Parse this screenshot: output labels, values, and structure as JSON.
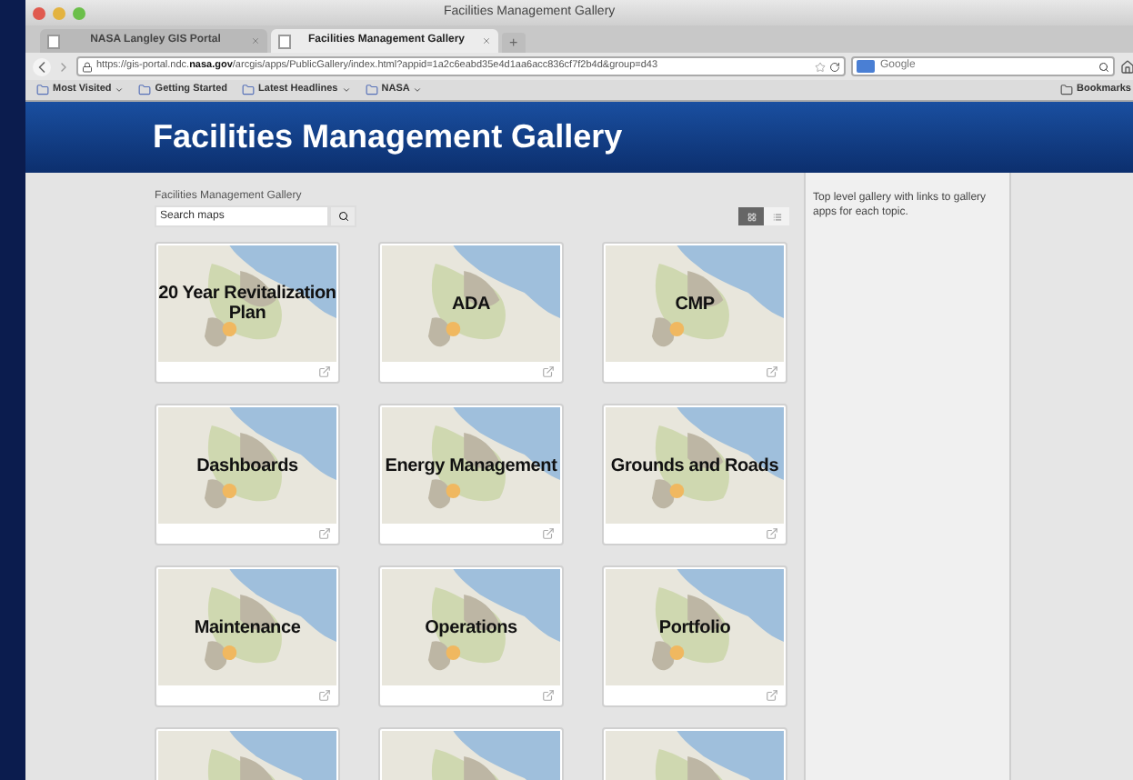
{
  "window": {
    "title": "Facilities Management Gallery"
  },
  "tabs": [
    {
      "label": "NASA Langley GIS Portal",
      "selected": false
    },
    {
      "label": "Facilities Management Gallery",
      "selected": true
    }
  ],
  "new_tab": "+",
  "url": {
    "prefix": "https://gis-portal.ndc.",
    "bold": "nasa.gov",
    "rest": "/arcgis/apps/PublicGallery/index.html?appid=1a2c6eabd35e4d1aa6acc836cf7f2b4d&group=d43"
  },
  "search_engine": {
    "placeholder": "Google"
  },
  "bookmarks": [
    {
      "label": "Most Visited",
      "menu": true
    },
    {
      "label": "Getting Started",
      "menu": false
    },
    {
      "label": "Latest Headlines",
      "menu": true
    },
    {
      "label": "NASA",
      "menu": true
    }
  ],
  "bookmarks_menu": "Bookmarks",
  "page": {
    "header": "Facilities Management Gallery",
    "breadcrumb": "Facilities Management Gallery",
    "search": {
      "placeholder": "Search maps"
    },
    "views": [
      {
        "kind": "grid",
        "selected": true
      },
      {
        "kind": "list",
        "selected": false
      }
    ],
    "tiles": [
      {
        "kind": "map",
        "title": "20 Year Revitalization Plan"
      },
      {
        "kind": "map",
        "title": "ADA"
      },
      {
        "kind": "map",
        "title": "CMP"
      },
      {
        "kind": "map",
        "title": "Dashboards"
      },
      {
        "kind": "map",
        "title": "Energy Management"
      },
      {
        "kind": "map",
        "title": "Grounds and Roads"
      },
      {
        "kind": "map",
        "title": "Maintenance"
      },
      {
        "kind": "map",
        "title": "Operations"
      },
      {
        "kind": "map",
        "title": "Portfolio"
      },
      {
        "kind": "cut"
      },
      {
        "kind": "cut"
      },
      {
        "kind": "cut"
      }
    ],
    "sidebar": "Top level gallery with links to gallery apps for each topic."
  }
}
